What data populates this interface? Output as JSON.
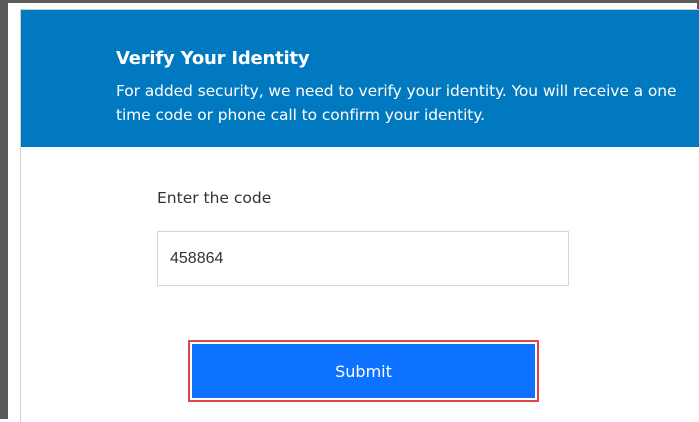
{
  "header": {
    "title": "Verify Your Identity",
    "description": "For added security, we need to verify your identity. You will receive a one time code or phone call to confirm your identity."
  },
  "form": {
    "code_label": "Enter the code",
    "code_value": "458864",
    "submit_label": "Submit"
  },
  "colors": {
    "header_bg": "#0079c1",
    "button_bg": "#0d72ff",
    "highlight_border": "#e04646"
  }
}
